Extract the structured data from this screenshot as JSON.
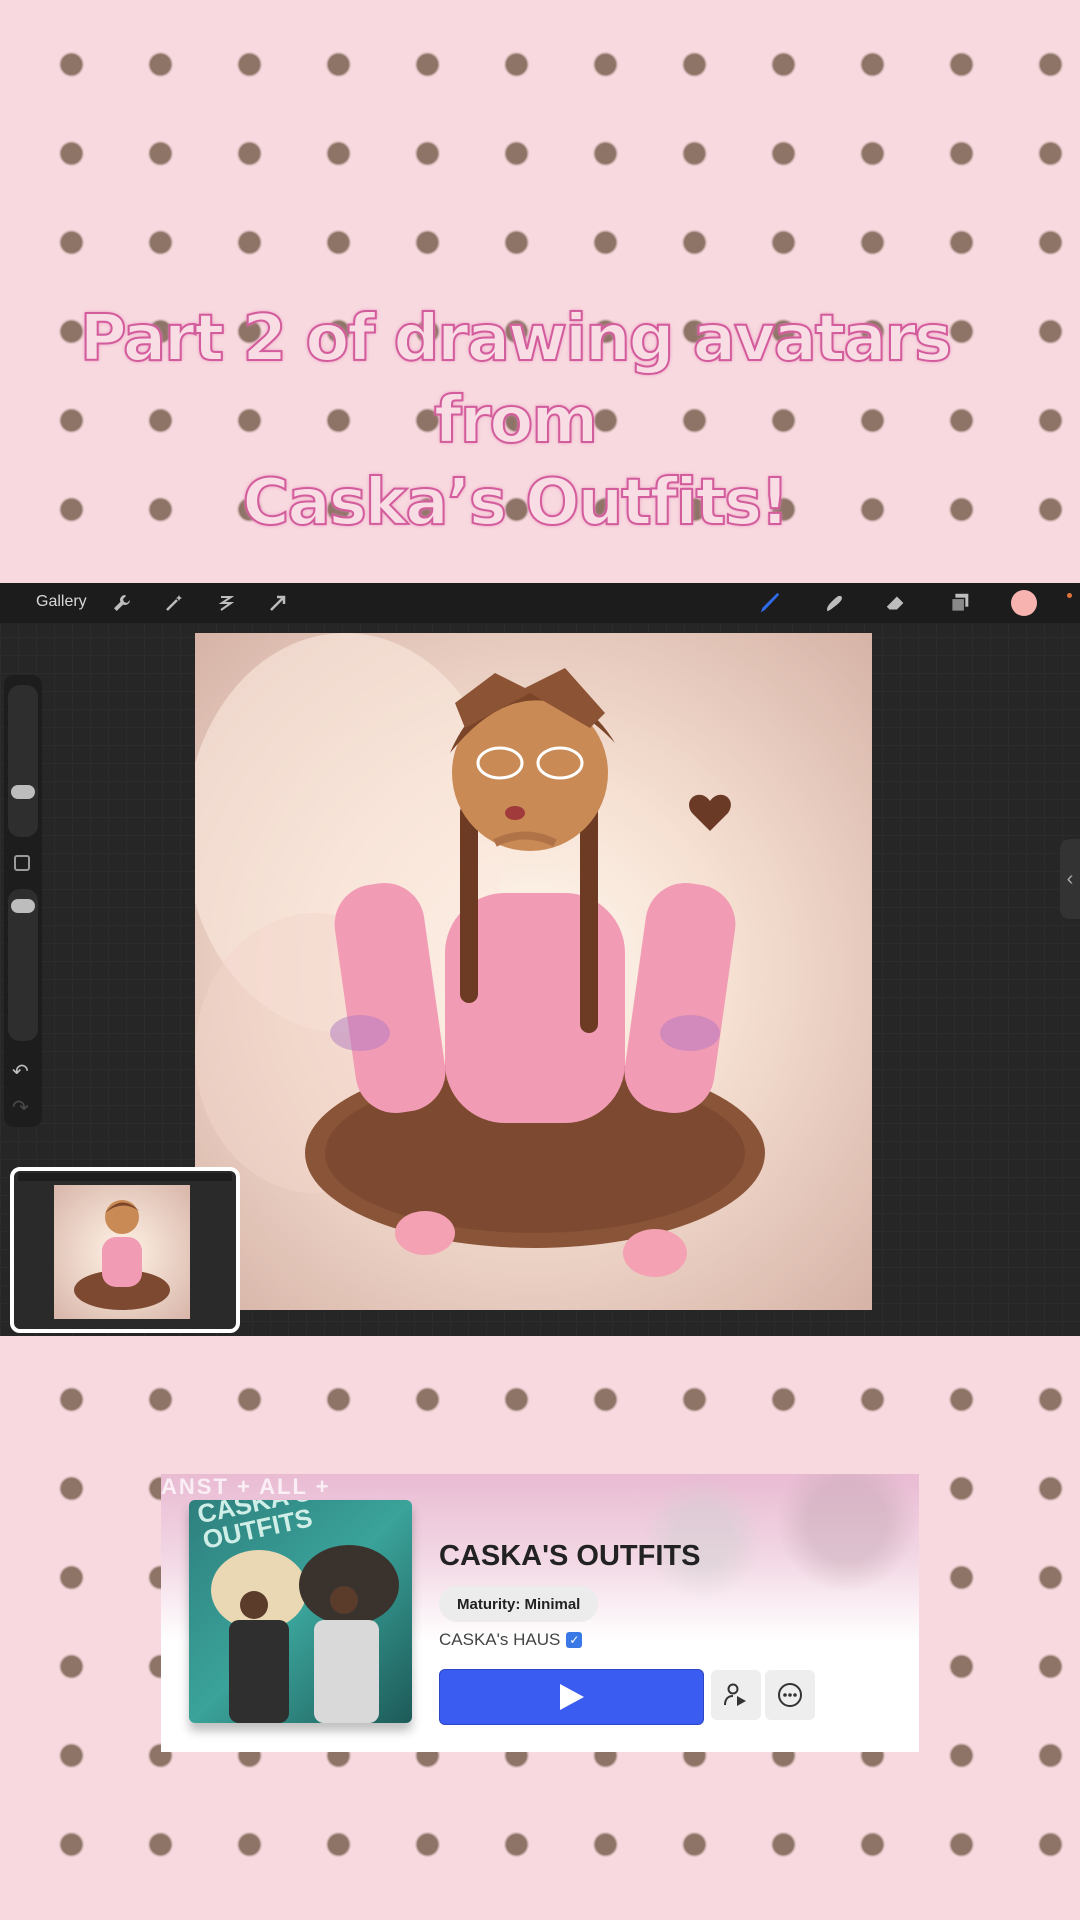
{
  "headline": {
    "line1": "Part 2 of drawing avatars from",
    "line2": "Caska’s Outfits!"
  },
  "procreate": {
    "gallery_label": "Gallery",
    "left_icons": [
      "wrench-icon",
      "magic-wand-icon",
      "selection-icon",
      "transform-arrow-icon"
    ],
    "right_icons": [
      "brush-icon",
      "smudge-icon",
      "eraser-icon",
      "layers-icon",
      "color-swatch-icon"
    ],
    "brush_color": "#2f6be8",
    "current_color": "#f7b3b0"
  },
  "game_card": {
    "watermark_text": "ANST + ALL +",
    "thumb_text": "CASKA'S OUTFITS",
    "title": "CASKA'S OUTFITS",
    "maturity": "Maturity: Minimal",
    "creator": "CASKA's HAUS",
    "play_color": "#3b5cf0"
  }
}
